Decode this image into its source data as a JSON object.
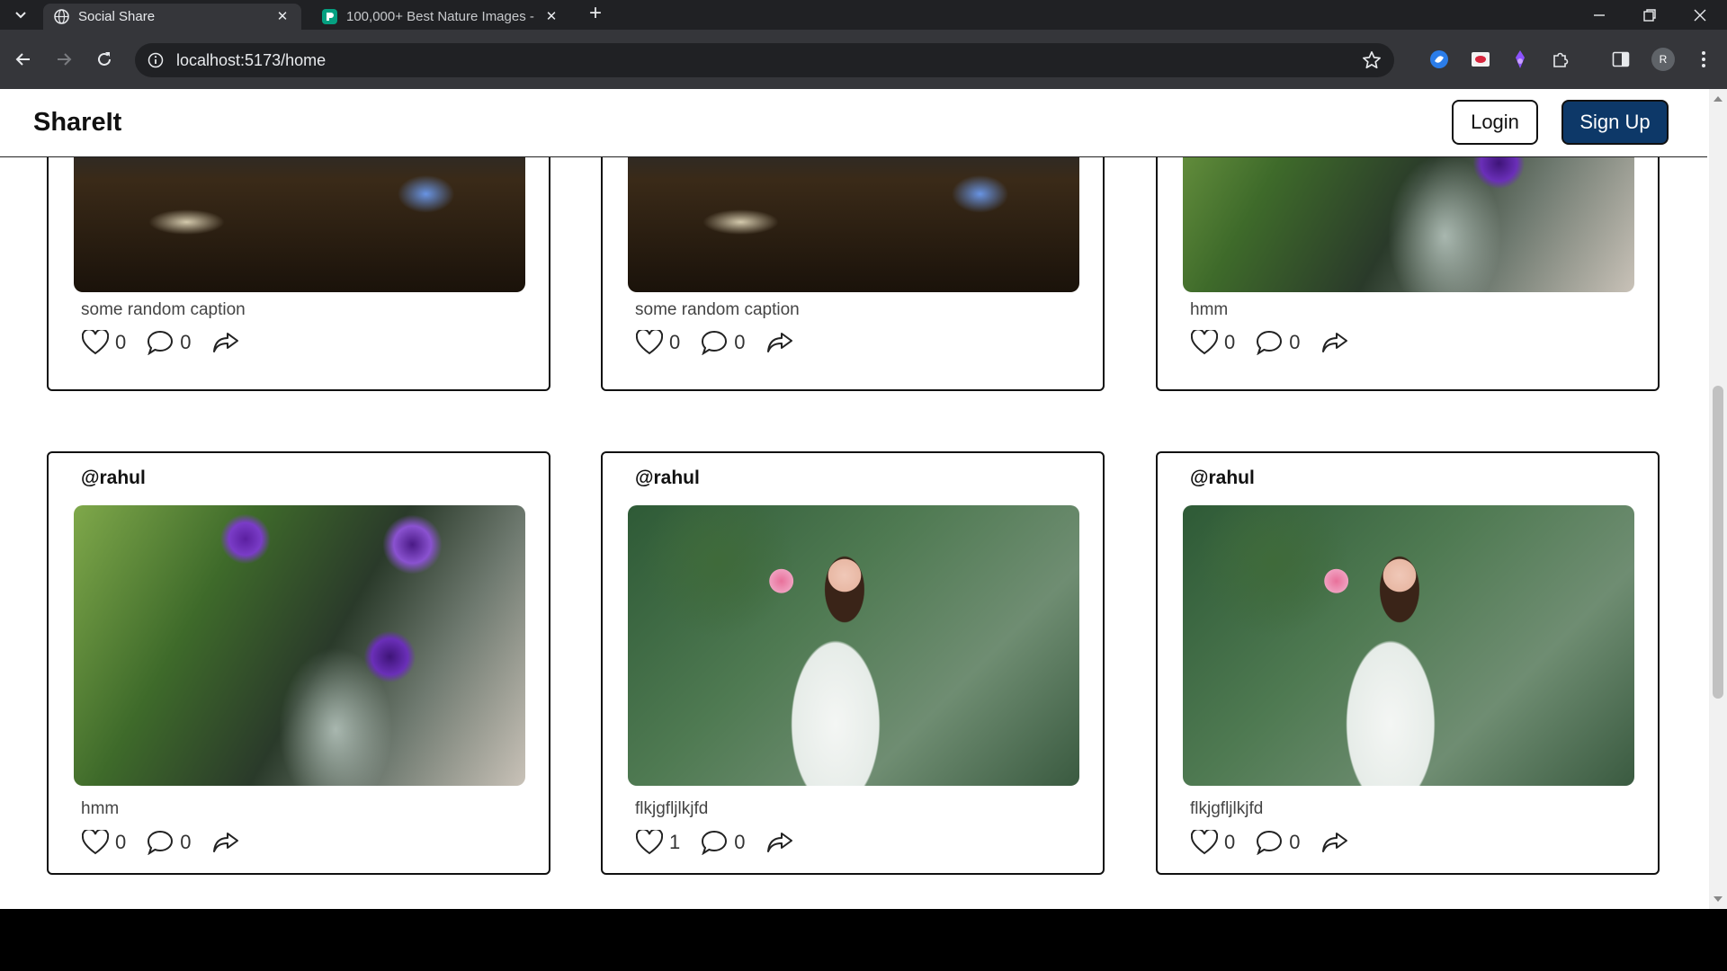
{
  "browser": {
    "tabs": [
      {
        "title": "Social Share",
        "active": true
      },
      {
        "title": "100,000+ Best Nature Images -",
        "active": false
      }
    ],
    "url": "localhost:5173/home",
    "profile_initial": "R"
  },
  "app": {
    "brand": "ShareIt",
    "login_label": "Login",
    "signup_label": "Sign Up"
  },
  "posts_row1": [
    {
      "caption": "some random caption",
      "likes": "0",
      "comments": "0",
      "image": "butterfly-mushroom-night"
    },
    {
      "caption": "some random caption",
      "likes": "0",
      "comments": "0",
      "image": "butterfly-mushroom-night"
    },
    {
      "caption": "hmm",
      "likes": "0",
      "comments": "0",
      "image": "purple-flowers-vase"
    }
  ],
  "posts_row2": [
    {
      "user": "@rahul",
      "caption": "hmm",
      "likes": "0",
      "comments": "0",
      "image": "purple-flowers-vase"
    },
    {
      "user": "@rahul",
      "caption": "flkjgfljlkjfd",
      "likes": "1",
      "comments": "0",
      "image": "woman-with-pink-flowers"
    },
    {
      "user": "@rahul",
      "caption": "flkjgfljlkjfd",
      "likes": "0",
      "comments": "0",
      "image": "woman-with-pink-flowers"
    }
  ],
  "colors": {
    "signup_bg": "#0d3868",
    "chrome_dark": "#202124",
    "chrome_toolbar": "#35363a"
  }
}
